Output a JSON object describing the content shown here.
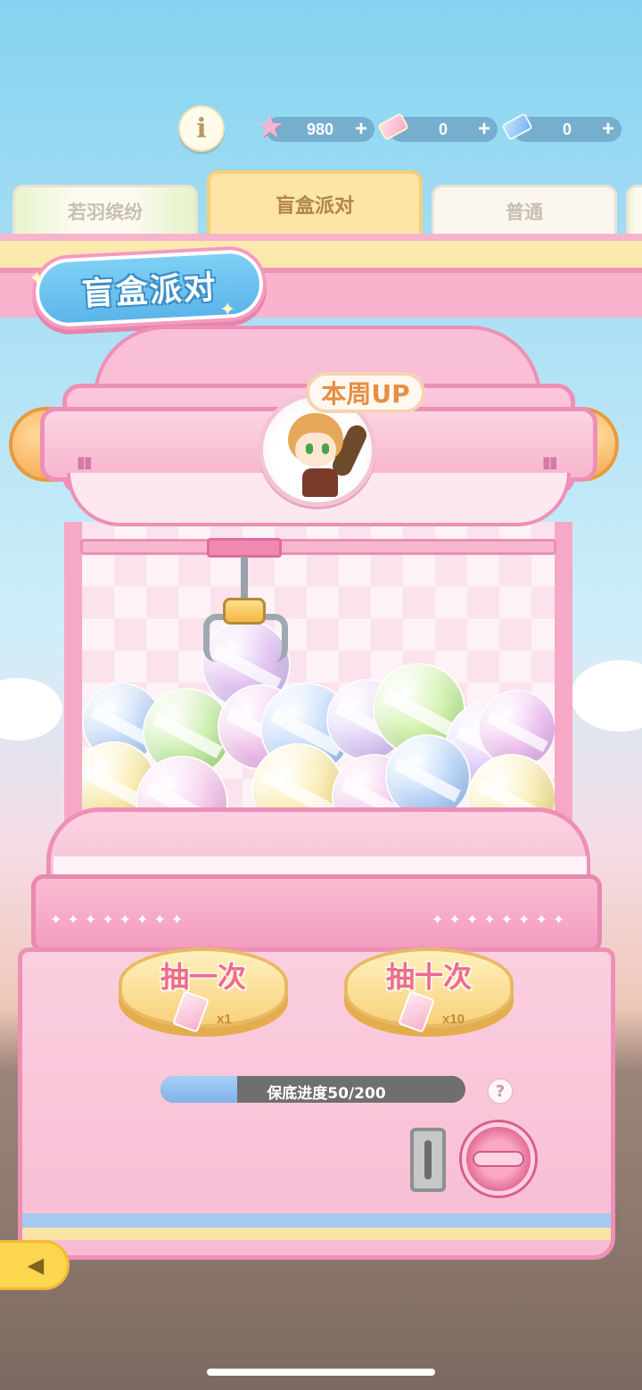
{
  "info_label": "i",
  "currencies": [
    {
      "icon": "star-currency-icon",
      "value": "980",
      "plus": "+"
    },
    {
      "icon": "pink-ticket-icon",
      "value": "0",
      "plus": "+"
    },
    {
      "icon": "blue-ticket-icon",
      "value": "0",
      "plus": "+"
    }
  ],
  "tabs": [
    {
      "label": "若羽缤纷",
      "active": false
    },
    {
      "label": "盲盒派对",
      "active": true
    },
    {
      "label": "普通",
      "active": false
    }
  ],
  "banner": {
    "title": "盲盒派对"
  },
  "featured": {
    "tag": "本周UP"
  },
  "draw_buttons": [
    {
      "label": "抽一次",
      "count": "x1"
    },
    {
      "label": "抽十次",
      "count": "x10"
    }
  ],
  "pity": {
    "text": "保底进度50/200",
    "current": 50,
    "total": 200
  },
  "help_label": "?",
  "back_icon": "back-arrow-icon",
  "colors": {
    "accent_pink": "#ee8fb7",
    "button_gold": "#f8d27c",
    "label_pink": "#ee6a93",
    "sky": "#84d3f0"
  }
}
